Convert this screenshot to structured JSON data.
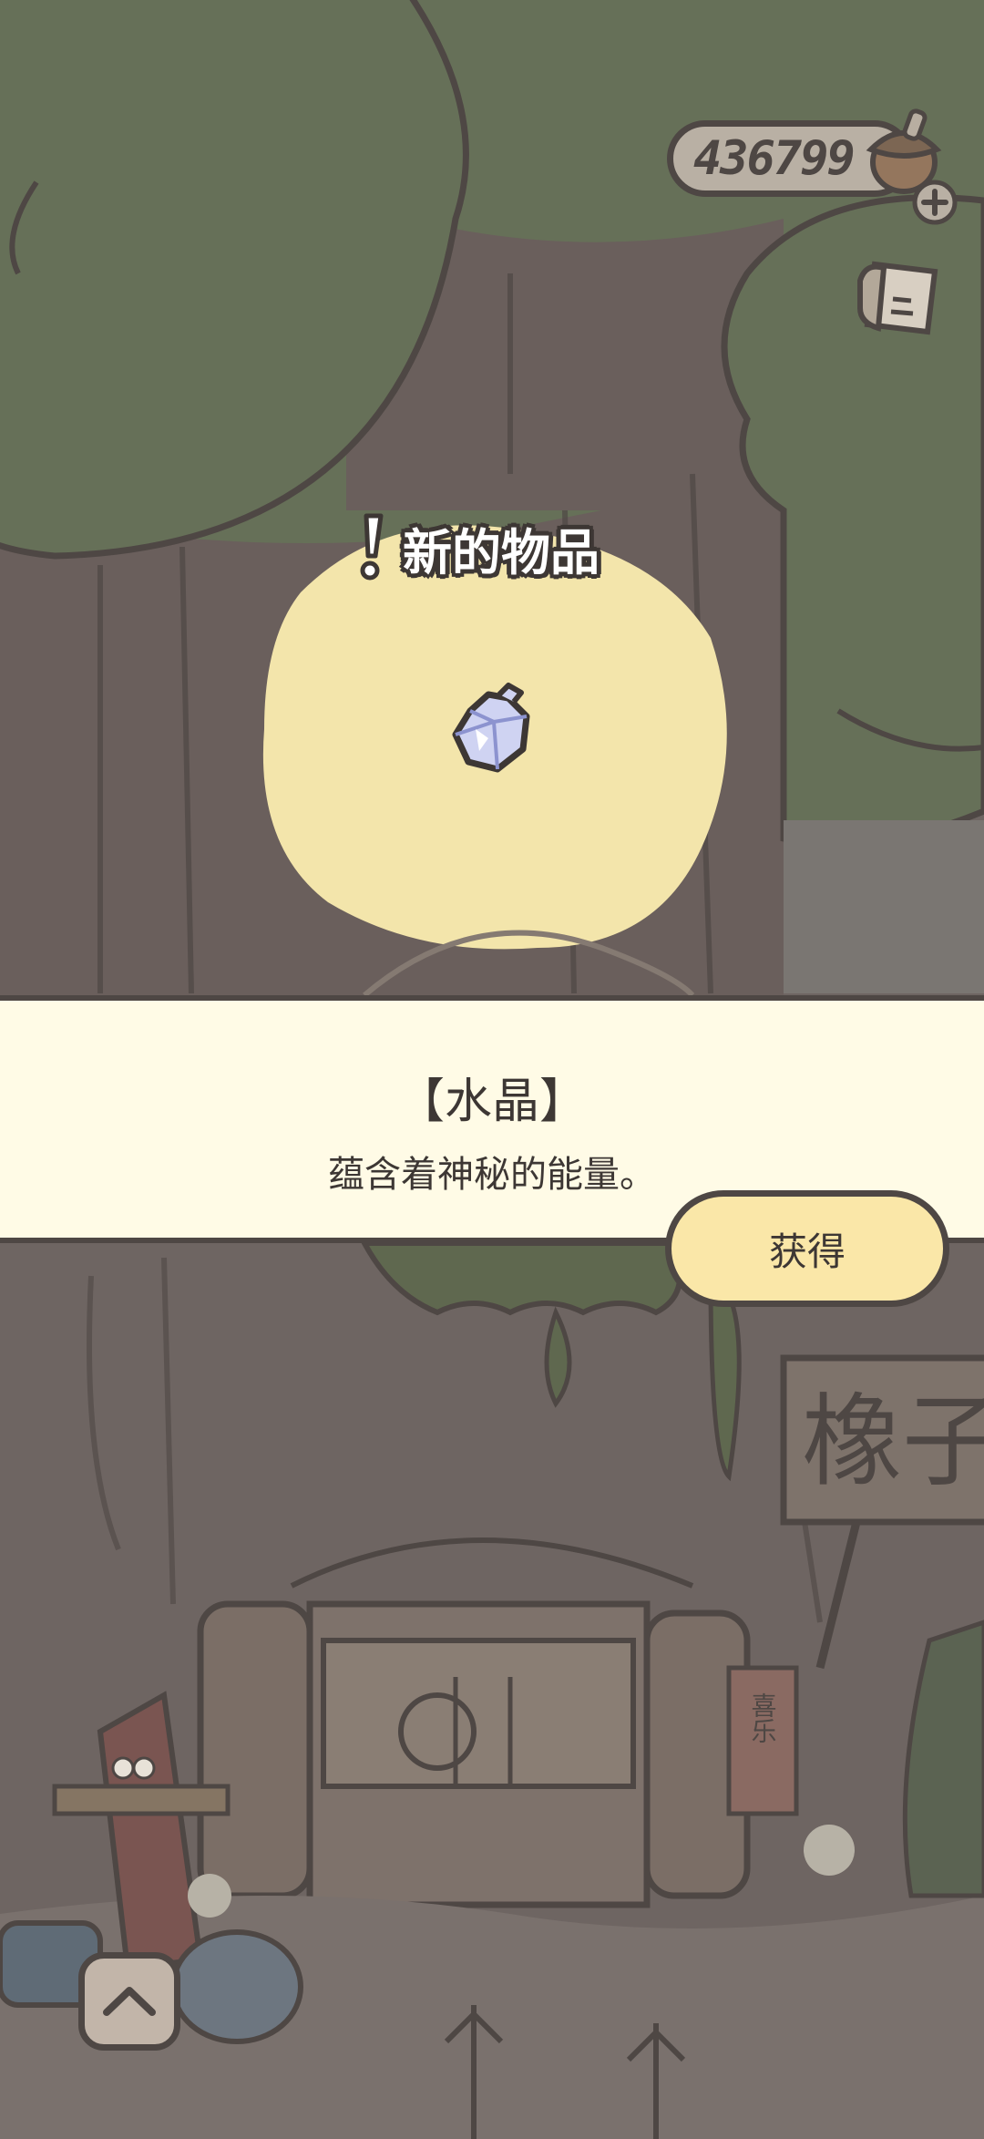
{
  "hud": {
    "acorn_count": "436799",
    "acorn_icon": "acorn-icon",
    "add_icon": "plus-icon",
    "notes_icon": "notes-icon"
  },
  "notification": {
    "label": "新的物品",
    "item_icon": "crystal-icon"
  },
  "item": {
    "name": "【水晶】",
    "description": "蕴含着神秘的能量。"
  },
  "actions": {
    "obtain_label": "获得",
    "menu_icon": "chevron-up-icon"
  },
  "scene": {
    "sign_text": "橡子",
    "couplet_text": "喜乐"
  },
  "colors": {
    "outline": "#4e4744",
    "panel_bg": "#fffbe6",
    "button_bg": "#fae7a8",
    "spotlight": "#f3e5ab",
    "foliage": "#667058"
  }
}
